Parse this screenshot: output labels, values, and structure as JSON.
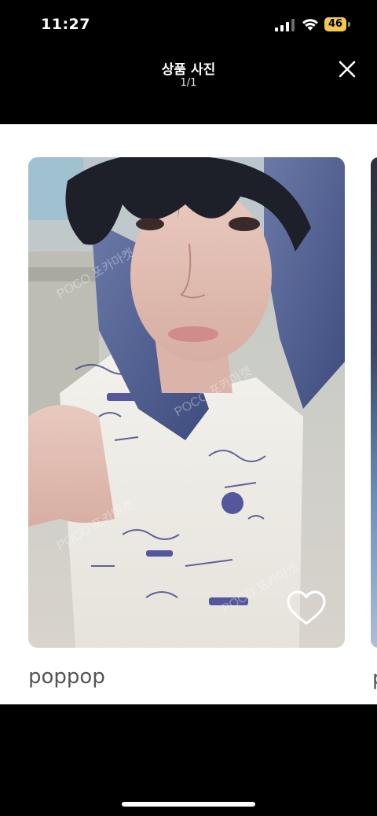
{
  "status_bar": {
    "time": "11:27",
    "battery_level": "46",
    "icons": [
      "signal-icon",
      "wifi-icon",
      "battery-icon"
    ]
  },
  "header": {
    "title": "상품 사진",
    "counter": "1/1",
    "close_icon": "close-icon"
  },
  "photo": {
    "caption": "poppop",
    "next_caption_peek": "p",
    "like_icon": "heart-outline-icon",
    "watermark": "POCO 포카마켓"
  },
  "colors": {
    "background": "#000000",
    "panel": "#ffffff",
    "battery": "#f2c94c",
    "caption": "#555555"
  }
}
